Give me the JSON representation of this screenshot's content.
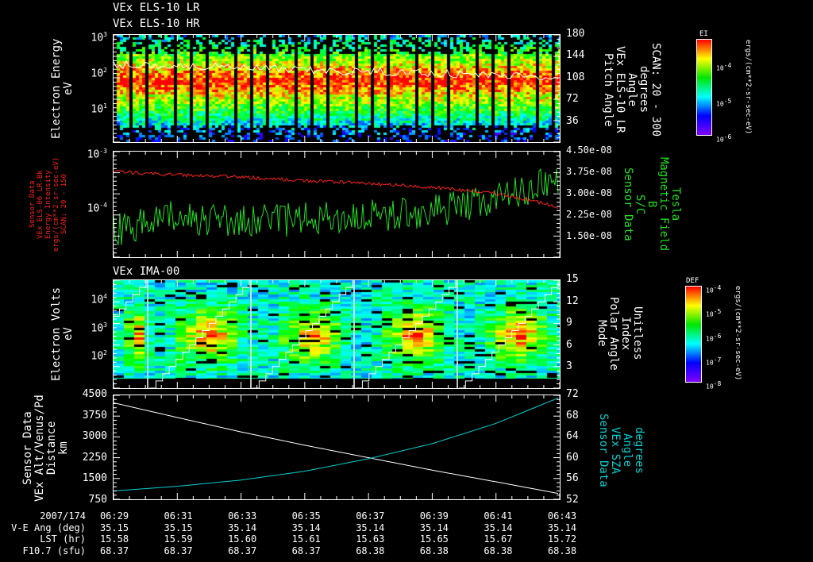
{
  "titles": {
    "p1a": "VEx ELS-10 LR",
    "p1b": "VEx ELS-10 HR",
    "p3": "VEx IMA-00"
  },
  "panel1": {
    "ylabel": [
      "Electron Energy",
      "eV"
    ],
    "yticks": [
      "10",
      "10",
      "10"
    ],
    "yexp": [
      "3",
      "2",
      "1"
    ],
    "right_ticks": [
      "180",
      "144",
      "108",
      "72",
      "36"
    ],
    "right_label": [
      "Pitch Angle",
      "VEx ELS-10 LR",
      "Angle",
      "degrees",
      "SCAN: 20 - 300"
    ],
    "colorbar": {
      "title": "EI",
      "ticks": [
        "10",
        "10",
        "10"
      ],
      "exp": [
        "-4",
        "-5",
        "-6"
      ],
      "units": "ergs/(cm**2-sr-sec-eV)"
    }
  },
  "panel2": {
    "left_label": [
      "Sensor Data",
      "VEx ELS-06 LR-Bk",
      "Energy Intensity",
      "ergs/(cm**2-sr-sec-eV)",
      "SCAN: 20 - 150"
    ],
    "yticks": [
      "10",
      "10"
    ],
    "yexp": [
      "-3",
      "-4"
    ],
    "right_ticks": [
      "4.50e-08",
      "3.75e-08",
      "3.00e-08",
      "2.25e-08",
      "1.50e-08"
    ],
    "right_label": [
      "Sensor Data",
      "S/C",
      "B",
      "Magnetic Field",
      "Tesla"
    ],
    "colors": {
      "energy": "#ff2020",
      "field": "#20e020"
    }
  },
  "panel3": {
    "ylabel": [
      "Electron Volts",
      "eV"
    ],
    "yticks": [
      "10",
      "10",
      "10"
    ],
    "yexp": [
      "4",
      "3",
      "2"
    ],
    "right_ticks": [
      "15",
      "12",
      "9",
      "6",
      "3"
    ],
    "right_label": [
      "Mode",
      "Polar Angle",
      "Index",
      "Unitless"
    ],
    "colorbar": {
      "title": "DEF",
      "ticks": [
        "10",
        "10",
        "10",
        "10",
        "10"
      ],
      "exp": [
        "-4",
        "-5",
        "-6",
        "-7",
        "-8"
      ],
      "units": "ergs/(cm**2-sr-sec-eV)"
    }
  },
  "panel4": {
    "left_label": [
      "Sensor Data",
      "VEx Alt/Venus/Pd",
      "Distance",
      "km"
    ],
    "yticks": [
      "4500",
      "3750",
      "3000",
      "2250",
      "1500",
      "750"
    ],
    "right_ticks": [
      "72",
      "68",
      "64",
      "60",
      "56",
      "52"
    ],
    "right_label": [
      "Sensor Data",
      "VEx SZA",
      "Angle",
      "degrees"
    ],
    "colors": {
      "alt": "#ffffff",
      "sza": "#00d0d0"
    }
  },
  "footer": {
    "labels": [
      "2007/174",
      "V-E Ang (deg)",
      "LST (hr)",
      "F10.7 (sfu)"
    ],
    "times": [
      "06:29",
      "06:31",
      "06:33",
      "06:35",
      "06:37",
      "06:39",
      "06:41",
      "06:43"
    ],
    "ve_ang": [
      "35.15",
      "35.15",
      "35.14",
      "35.14",
      "35.14",
      "35.14",
      "35.14",
      "35.14"
    ],
    "lst": [
      "15.58",
      "15.59",
      "15.60",
      "15.61",
      "15.63",
      "15.65",
      "15.67",
      "15.72"
    ],
    "f107": [
      "68.37",
      "68.37",
      "68.37",
      "68.37",
      "68.38",
      "68.38",
      "68.38",
      "68.38"
    ]
  },
  "chart_data": [
    {
      "type": "heatmap",
      "title": "VEx ELS-10 LR / HR",
      "ylabel": "Electron Energy (eV)",
      "ylim": [
        1,
        1000
      ],
      "yscale": "log",
      "peak_energy_eV": 60,
      "overlay": "Pitch Angle (deg), 0-180",
      "overlay_approx": [
        130,
        128,
        125,
        120,
        118,
        116,
        112,
        110
      ]
    },
    {
      "type": "line",
      "ylabel_left": "Energy Intensity",
      "ylim_left": [
        1e-05,
        0.001
      ],
      "ylabel_right": "Magnetic Field (Tesla)",
      "ylim_right": [
        7.5e-09,
        4.5e-08
      ],
      "x": [
        "06:29",
        "06:31",
        "06:33",
        "06:35",
        "06:37",
        "06:39",
        "06:41",
        "06:43"
      ],
      "series": [
        {
          "name": "VEx ELS-06 LR-Bk",
          "axis": "left",
          "values": [
            0.00042,
            0.00036,
            0.00033,
            0.00028,
            0.00025,
            0.00021,
            0.00016,
            8.5e-05
          ]
        },
        {
          "name": "S/C B",
          "axis": "right",
          "values": [
            1.7e-08,
            2.2e-08,
            2e-08,
            2.1e-08,
            2.2e-08,
            2.4e-08,
            2.8e-08,
            3.6e-08
          ]
        }
      ]
    },
    {
      "type": "heatmap",
      "title": "VEx IMA-00",
      "ylabel": "Electron Volts (eV)",
      "ylim": [
        10,
        30000
      ],
      "yscale": "log",
      "overlay": "Polar Angle Index 0-15"
    },
    {
      "type": "line",
      "x": [
        "06:29",
        "06:31",
        "06:33",
        "06:35",
        "06:37",
        "06:39",
        "06:41",
        "06:43"
      ],
      "series": [
        {
          "name": "VEx Alt/Venus/Pd (km)",
          "axis": "left",
          "ylim": [
            750,
            4500
          ],
          "values": [
            4230,
            3700,
            3180,
            2700,
            2250,
            1800,
            1380,
            950
          ]
        },
        {
          "name": "VEx SZA (degrees)",
          "axis": "right",
          "ylim": [
            52,
            72
          ],
          "values": [
            53.6,
            54.5,
            55.7,
            57.4,
            59.8,
            62.7,
            66.6,
            71.6
          ]
        }
      ]
    }
  ]
}
